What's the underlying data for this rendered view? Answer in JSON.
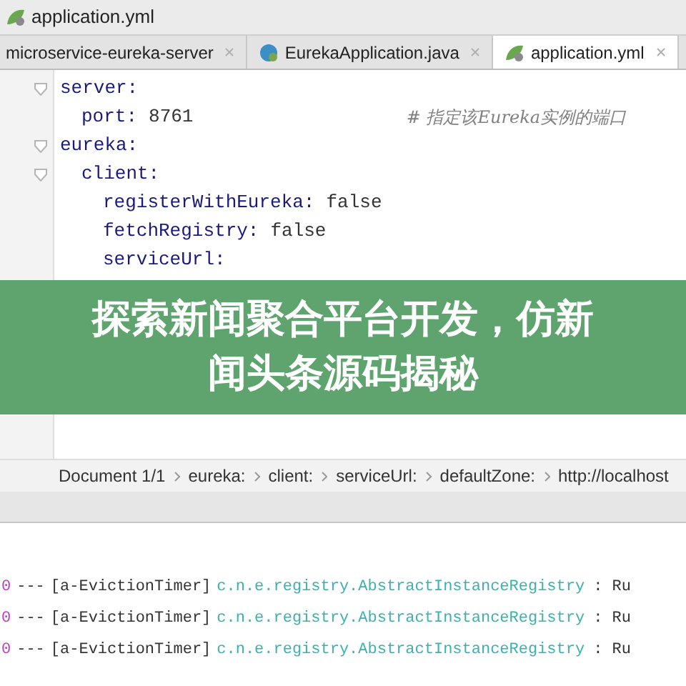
{
  "breadcrumb_bar": {
    "file": "application.yml"
  },
  "tabs": [
    {
      "label": "microservice-eureka-server",
      "selected": false
    },
    {
      "label": "EurekaApplication.java",
      "selected": false
    },
    {
      "label": "application.yml",
      "selected": true
    }
  ],
  "editor": {
    "lines": [
      {
        "key": "server:",
        "children": [
          {
            "key": "port:",
            "value": "8761",
            "comment": "# 指定该Eureka实例的端口"
          }
        ]
      },
      {
        "key": "eureka:",
        "children": [
          {
            "key": "client:",
            "children": [
              {
                "key": "registerWithEureka:",
                "value": "false"
              },
              {
                "key": "fetchRegistry:",
                "value": "false"
              },
              {
                "key": "serviceUrl:"
              }
            ]
          }
        ]
      }
    ]
  },
  "status_path": [
    "Document 1/1",
    "eureka:",
    "client:",
    "serviceUrl:",
    "defaultZone:",
    "http://localhost"
  ],
  "console": [
    {
      "pid": "0",
      "sep": "---",
      "thread": "[a-EvictionTimer]",
      "logger": "c.n.e.registry.AbstractInstanceRegistry",
      "message": ": Ru"
    },
    {
      "pid": "0",
      "sep": "---",
      "thread": "[a-EvictionTimer]",
      "logger": "c.n.e.registry.AbstractInstanceRegistry",
      "message": ": Ru"
    },
    {
      "pid": "0",
      "sep": "---",
      "thread": "[a-EvictionTimer]",
      "logger": "c.n.e.registry.AbstractInstanceRegistry",
      "message": ": Ru"
    }
  ],
  "banner": {
    "lines": [
      "探索新闻聚合平台开发，仿新",
      "闻头条源码揭秘"
    ]
  }
}
